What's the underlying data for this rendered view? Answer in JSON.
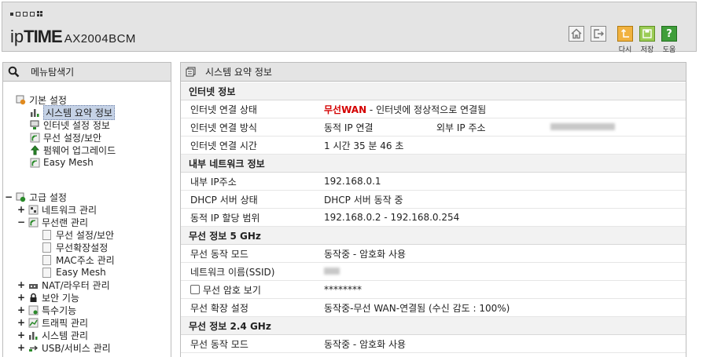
{
  "header": {
    "brand_ip": "ip",
    "brand_time": "TIME",
    "model": "AX2004BCM",
    "buttons": [
      {
        "icon": "home-icon"
      },
      {
        "icon": "logout-icon"
      },
      {
        "icon": "refresh-icon",
        "label": "다시"
      },
      {
        "icon": "save-icon",
        "label": "저장"
      },
      {
        "icon": "help-icon",
        "label": "도움"
      }
    ]
  },
  "left": {
    "title": "메뉴탐색기",
    "basic": {
      "label": "기본 설정",
      "items": [
        "시스템 요약 정보",
        "인터넷 설정 정보",
        "무선 설정/보안",
        "펌웨어 업그레이드",
        "Easy Mesh"
      ]
    },
    "advanced": {
      "label": "고급 설정",
      "items": [
        "네트워크 관리",
        "무선랜 관리",
        "NAT/라우터 관리",
        "보안 기능",
        "특수기능",
        "트래픽 관리",
        "시스템 관리",
        "USB/서비스 관리"
      ],
      "wireless_sub": [
        "무선 설정/보안",
        "무선확장설정",
        "MAC주소 관리",
        "Easy Mesh"
      ]
    }
  },
  "right": {
    "title": "시스템 요약 정보",
    "sections": {
      "internet": "인터넷 정보",
      "lan": "내부 네트워크 정보",
      "w5": "무선 정보 5 GHz",
      "w24": "무선 정보 2.4 GHz"
    },
    "internet": {
      "state_label": "인터넷 연결 상태",
      "state_wan": "무선WAN",
      "state_text": " - 인터넷에 정상적으로 연결됨",
      "method_label": "인터넷 연결 방식",
      "method_value": "동적 IP 연결",
      "ext_ip_label": "외부 IP 주소",
      "time_label": "인터넷 연결 시간",
      "time_value": "1 시간 35 분 46 초"
    },
    "lan": {
      "ip_label": "내부 IP주소",
      "ip_value": "192.168.0.1",
      "dhcp_label": "DHCP 서버 상태",
      "dhcp_value": "DHCP 서버 동작 중",
      "range_label": "동적 IP 할당 범위",
      "range_value": "192.168.0.2 -  192.168.0.254"
    },
    "w5": {
      "mode_label": "무선 동작 모드",
      "mode_value": "동작중 - 암호화 사용",
      "ssid_label": "네트워크 이름(SSID)",
      "pw_label": "무선 암호 보기",
      "pw_value": "********",
      "ext_label": "무선 확장 설정",
      "ext_value": "동작중-무선 WAN-연결됨 (수신 감도 : 100%)"
    },
    "w24": {
      "mode_label": "무선 동작 모드",
      "mode_value": "동작중 - 암호화 사용"
    }
  }
}
